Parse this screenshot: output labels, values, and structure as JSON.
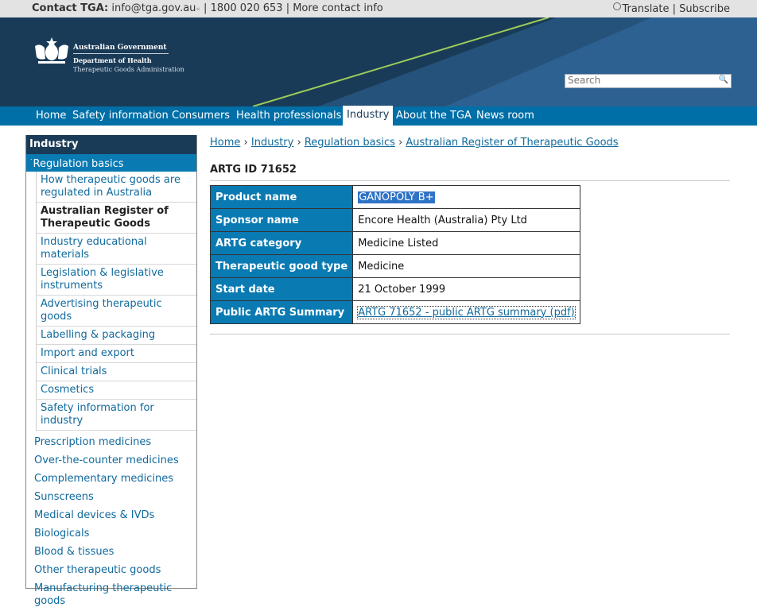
{
  "topbar": {
    "contact_label": "Contact TGA:",
    "email": "info@tga.gov.au",
    "email_suffix": "«",
    "phone": "1800 020 653",
    "more_contact": "More contact info",
    "translate": "Translate",
    "subscribe": "Subscribe"
  },
  "header": {
    "gov_line1": "Australian Government",
    "gov_line2": "Department of Health",
    "gov_line3": "Therapeutic Goods Administration",
    "search_placeholder": "Search"
  },
  "nav": {
    "items": [
      "Home",
      "Safety information",
      "Consumers",
      "Health professionals",
      "Industry",
      "About the TGA",
      "News room"
    ],
    "active": "Industry"
  },
  "sidebar": {
    "heading": "Industry",
    "selected": "Regulation basics",
    "sub_items": [
      "How therapeutic goods are regulated in Australia",
      "Australian Register of Therapeutic Goods",
      "Industry educational materials",
      "Legislation & legislative instruments",
      "Advertising therapeutic goods",
      "Labelling & packaging",
      "Import and export",
      "Clinical trials",
      "Cosmetics",
      "Safety information for industry"
    ],
    "top_items": [
      "Prescription medicines",
      "Over-the-counter medicines",
      "Complementary medicines",
      "Sunscreens",
      "Medical devices & IVDs",
      "Biologicals",
      "Blood & tissues",
      "Other therapeutic goods",
      "Manufacturing therapeutic goods"
    ]
  },
  "breadcrumb": [
    "Home",
    "Industry",
    "Regulation basics",
    "Australian Register of Therapeutic Goods"
  ],
  "breadcrumb_sep": "›",
  "artg": {
    "id_heading": "ARTG ID 71652",
    "rows": [
      {
        "label": "Product name",
        "value": "GANOPOLY B+"
      },
      {
        "label": "Sponsor name",
        "value": "Encore Health (Australia) Pty Ltd"
      },
      {
        "label": "ARTG category",
        "value": "Medicine Listed"
      },
      {
        "label": "Therapeutic good type",
        "value": "Medicine"
      },
      {
        "label": "Start date",
        "value": "21 October 1999"
      },
      {
        "label": "Public ARTG Summary",
        "value": "ARTG 71652 - public ARTG summary (pdf)"
      }
    ]
  },
  "colors": {
    "banner": "#1a3b57",
    "nav": "#006fa7",
    "label_cell": "#0a7ab3",
    "link": "#106a9d",
    "swoosh": "#9ccc5a"
  }
}
